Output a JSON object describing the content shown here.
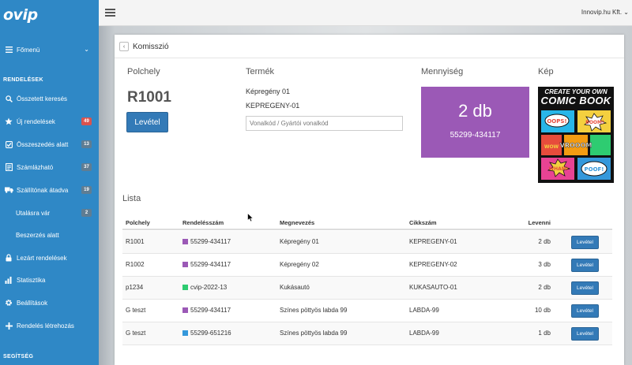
{
  "app": {
    "logo": "ovip",
    "company": "Innovip.hu Kft."
  },
  "colors": {
    "sidebar": "#2f88c6",
    "primary": "#337ab7",
    "quantity_box": "#9b59b6",
    "badge_red": "#d9534f",
    "badge_gray": "#5f7d93"
  },
  "sidebar": {
    "main_item": {
      "label": "Főmenü"
    },
    "section_orders": "RENDELÉSEK",
    "items": [
      {
        "label": "Összetett keresés",
        "icon": "search-icon"
      },
      {
        "label": "Új rendelések",
        "icon": "star-icon",
        "badge": "49"
      },
      {
        "label": "Összeszedés alatt",
        "icon": "checkbox-icon",
        "badge": "13"
      },
      {
        "label": "Számlázható",
        "icon": "invoice-icon",
        "badge": "37"
      },
      {
        "label": "Szállítónak átadva",
        "icon": "truck-icon",
        "badge": "19"
      },
      {
        "label": "Utalásra vár",
        "badge": "2"
      },
      {
        "label": "Beszerzés alatt"
      },
      {
        "label": "Lezárt rendelések",
        "icon": "lock-icon"
      },
      {
        "label": "Statisztika",
        "icon": "chart-icon"
      },
      {
        "label": "Beállítások",
        "icon": "gear-icon"
      },
      {
        "label": "Rendelés létrehozás",
        "icon": "plus-icon"
      }
    ],
    "section_help": "SEGÍTSÉG"
  },
  "page": {
    "breadcrumb": "Komisszió"
  },
  "detail": {
    "location_label": "Polchely",
    "location_value": "R1001",
    "take_button": "Levétel",
    "product_label": "Termék",
    "product_name": "Képregény 01",
    "product_sku": "KEPREGENY-01",
    "barcode_placeholder": "Vonalkód / Gyártói vonalkód",
    "quantity_label": "Mennyiség",
    "quantity_value": "2 db",
    "quantity_order": "55299-434117",
    "image_label": "Kép",
    "image_text_line1": "CREATE YOUR OWN",
    "image_text_line2": "COMIC BOOK",
    "image_bubbles": [
      "OOPS!",
      "BOOM!",
      "VROOOM",
      "WOW",
      "WHAM!",
      "POOF!"
    ]
  },
  "list": {
    "title": "Lista",
    "columns": [
      "Polchely",
      "Rendelésszám",
      "Megnevezés",
      "Cikkszám",
      "Levenni"
    ],
    "button_label": "Levétel",
    "rows": [
      {
        "location": "R1001",
        "order": "55299-434117",
        "order_color": "#9b59b6",
        "name": "Képregény 01",
        "sku": "KEPREGENY-01",
        "qty": "2 db"
      },
      {
        "location": "R1002",
        "order": "55299-434117",
        "order_color": "#9b59b6",
        "name": "Képregény 02",
        "sku": "KEPREGENY-02",
        "qty": "3 db"
      },
      {
        "location": "p1234",
        "order": "cvip-2022-13",
        "order_color": "#2ecc71",
        "name": "Kukásautó",
        "sku": "KUKASAUTO-01",
        "qty": "2 db"
      },
      {
        "location": "G teszt",
        "order": "55299-434117",
        "order_color": "#9b59b6",
        "name": "Színes pöttyös labda 99",
        "sku": "LABDA-99",
        "qty": "10 db"
      },
      {
        "location": "G teszt",
        "order": "55299-651216",
        "order_color": "#3498db",
        "name": "Színes pöttyös labda 99",
        "sku": "LABDA-99",
        "qty": "1 db"
      }
    ]
  }
}
